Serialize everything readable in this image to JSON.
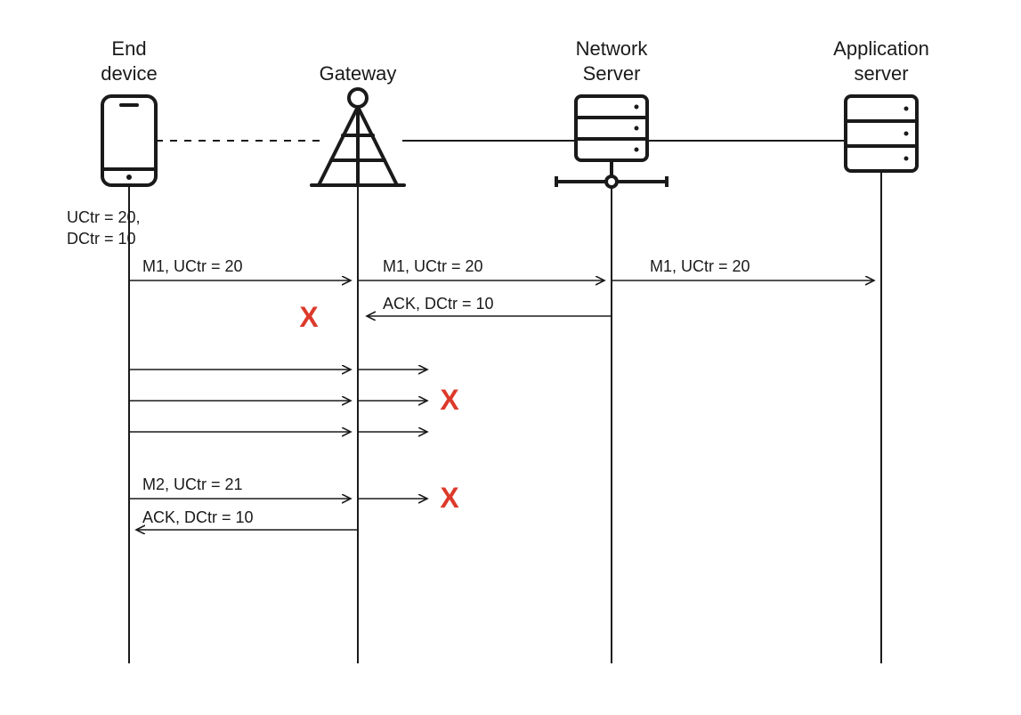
{
  "columns": {
    "end_device": {
      "label_line1": "End",
      "label_line2": "device"
    },
    "gateway": {
      "label": "Gateway"
    },
    "network_server": {
      "label_line1": "Network",
      "label_line2": "Server"
    },
    "application_server": {
      "label_line1": "Application",
      "label_line2": "server"
    }
  },
  "side_text": {
    "line1": "UCtr = 20,",
    "line2": "DCtr = 10"
  },
  "messages": {
    "m1_uctr20_a": "M1, UCtr = 20",
    "m1_uctr20_b": "M1, UCtr = 20",
    "m1_uctr20_c": "M1, UCtr = 20",
    "ack_dctr10_a": "ACK, DCtr = 10",
    "m2_uctr21": "M2, UCtr = 21",
    "ack_dctr10_b": "ACK, DCtr = 10"
  },
  "fail_marker": "X"
}
